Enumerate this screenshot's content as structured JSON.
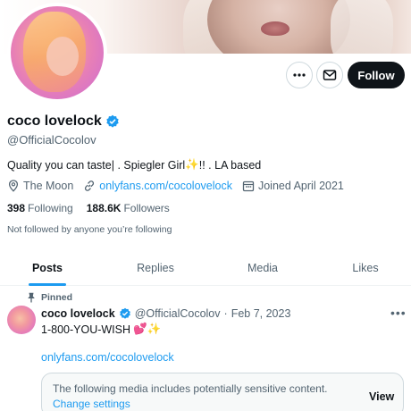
{
  "profile": {
    "name": "coco lovelock",
    "handle": "@OfficialCocolov",
    "bio_text": "Quality you can taste| . Spiegler Girl",
    "bio_emoji": "✨",
    "bio_tail": "!! . LA based",
    "location": "The Moon",
    "website": "onlyfans.com/cocolovelock",
    "joined": "Joined April 2021",
    "following_count": "398",
    "following_label": "Following",
    "followers_count": "188.6K",
    "followers_label": "Followers",
    "not_followed": "Not followed by anyone you’re following"
  },
  "actions": {
    "more_icon": "more-icon",
    "message_icon": "envelope-icon",
    "follow_label": "Follow"
  },
  "tabs": [
    {
      "label": "Posts",
      "active": true
    },
    {
      "label": "Replies",
      "active": false
    },
    {
      "label": "Media",
      "active": false
    },
    {
      "label": "Likes",
      "active": false
    }
  ],
  "tweet": {
    "pinned_label": "Pinned",
    "name": "coco lovelock",
    "handle": "@OfficialCocolov",
    "separator": "·",
    "date": "Feb 7, 2023",
    "text": "1-800-YOU-WISH",
    "emojis": "💕✨",
    "link": "onlyfans.com/cocolovelock",
    "sensitive_message": "The following media includes potentially sensitive content.",
    "change_settings": "Change settings",
    "view_label": "View"
  },
  "colors": {
    "accent": "#1d9bf0",
    "text": "#0f1419",
    "muted": "#536471"
  }
}
